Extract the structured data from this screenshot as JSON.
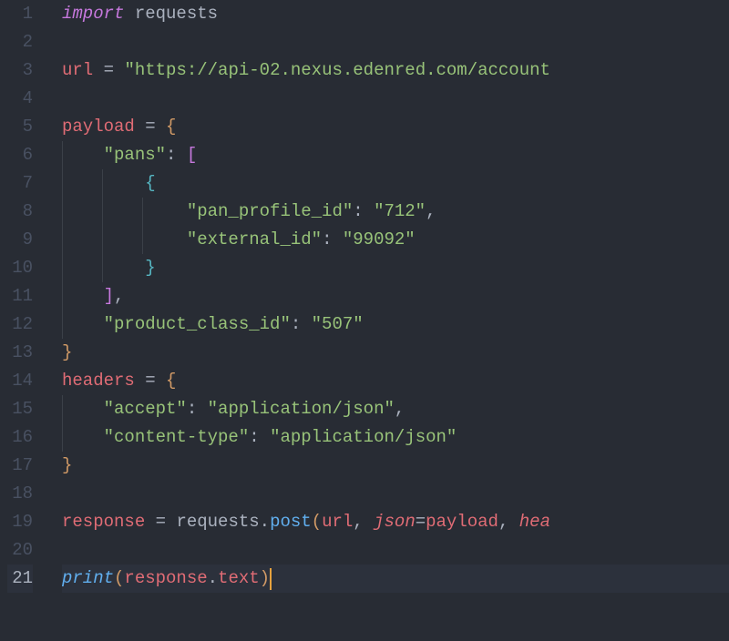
{
  "lines": [
    {
      "n": "1",
      "tokens": [
        {
          "t": "import",
          "c": "kw-import"
        },
        {
          "t": " ",
          "c": ""
        },
        {
          "t": "requests",
          "c": "module"
        }
      ]
    },
    {
      "n": "2",
      "tokens": []
    },
    {
      "n": "3",
      "tokens": [
        {
          "t": "url",
          "c": "var"
        },
        {
          "t": " ",
          "c": ""
        },
        {
          "t": "=",
          "c": "op"
        },
        {
          "t": " ",
          "c": ""
        },
        {
          "t": "\"https://api-02.nexus.edenred.com/account",
          "c": "str"
        }
      ]
    },
    {
      "n": "4",
      "tokens": []
    },
    {
      "n": "5",
      "tokens": [
        {
          "t": "payload",
          "c": "var"
        },
        {
          "t": " ",
          "c": ""
        },
        {
          "t": "=",
          "c": "op"
        },
        {
          "t": " ",
          "c": ""
        },
        {
          "t": "{",
          "c": "brace"
        }
      ]
    },
    {
      "n": "6",
      "indent": 1,
      "tokens": [
        {
          "t": "    ",
          "c": ""
        },
        {
          "t": "\"pans\"",
          "c": "str"
        },
        {
          "t": ":",
          "c": "punc"
        },
        {
          "t": " ",
          "c": ""
        },
        {
          "t": "[",
          "c": "brace2"
        }
      ]
    },
    {
      "n": "7",
      "indent": 2,
      "tokens": [
        {
          "t": "        ",
          "c": ""
        },
        {
          "t": "{",
          "c": "brace3"
        }
      ]
    },
    {
      "n": "8",
      "indent": 3,
      "tokens": [
        {
          "t": "            ",
          "c": ""
        },
        {
          "t": "\"pan_profile_id\"",
          "c": "str"
        },
        {
          "t": ":",
          "c": "punc"
        },
        {
          "t": " ",
          "c": ""
        },
        {
          "t": "\"712\"",
          "c": "str"
        },
        {
          "t": ",",
          "c": "punc"
        }
      ]
    },
    {
      "n": "9",
      "indent": 3,
      "tokens": [
        {
          "t": "            ",
          "c": ""
        },
        {
          "t": "\"external_id\"",
          "c": "str"
        },
        {
          "t": ":",
          "c": "punc"
        },
        {
          "t": " ",
          "c": ""
        },
        {
          "t": "\"99092\"",
          "c": "str"
        }
      ]
    },
    {
      "n": "10",
      "indent": 2,
      "tokens": [
        {
          "t": "        ",
          "c": ""
        },
        {
          "t": "}",
          "c": "brace3"
        }
      ]
    },
    {
      "n": "11",
      "indent": 1,
      "tokens": [
        {
          "t": "    ",
          "c": ""
        },
        {
          "t": "]",
          "c": "brace2"
        },
        {
          "t": ",",
          "c": "punc"
        }
      ]
    },
    {
      "n": "12",
      "indent": 1,
      "tokens": [
        {
          "t": "    ",
          "c": ""
        },
        {
          "t": "\"product_class_id\"",
          "c": "str"
        },
        {
          "t": ":",
          "c": "punc"
        },
        {
          "t": " ",
          "c": ""
        },
        {
          "t": "\"507\"",
          "c": "str"
        }
      ]
    },
    {
      "n": "13",
      "tokens": [
        {
          "t": "}",
          "c": "brace"
        }
      ]
    },
    {
      "n": "14",
      "tokens": [
        {
          "t": "headers",
          "c": "var"
        },
        {
          "t": " ",
          "c": ""
        },
        {
          "t": "=",
          "c": "op"
        },
        {
          "t": " ",
          "c": ""
        },
        {
          "t": "{",
          "c": "brace"
        }
      ]
    },
    {
      "n": "15",
      "indent": 1,
      "tokens": [
        {
          "t": "    ",
          "c": ""
        },
        {
          "t": "\"accept\"",
          "c": "str"
        },
        {
          "t": ":",
          "c": "punc"
        },
        {
          "t": " ",
          "c": ""
        },
        {
          "t": "\"application/json\"",
          "c": "str"
        },
        {
          "t": ",",
          "c": "punc"
        }
      ]
    },
    {
      "n": "16",
      "indent": 1,
      "tokens": [
        {
          "t": "    ",
          "c": ""
        },
        {
          "t": "\"content-type\"",
          "c": "str"
        },
        {
          "t": ":",
          "c": "punc"
        },
        {
          "t": " ",
          "c": ""
        },
        {
          "t": "\"application/json\"",
          "c": "str"
        }
      ]
    },
    {
      "n": "17",
      "tokens": [
        {
          "t": "}",
          "c": "brace"
        }
      ]
    },
    {
      "n": "18",
      "tokens": []
    },
    {
      "n": "19",
      "tokens": [
        {
          "t": "response",
          "c": "var"
        },
        {
          "t": " ",
          "c": ""
        },
        {
          "t": "=",
          "c": "op"
        },
        {
          "t": " ",
          "c": ""
        },
        {
          "t": "requests",
          "c": "module"
        },
        {
          "t": ".",
          "c": "punc"
        },
        {
          "t": "post",
          "c": "func"
        },
        {
          "t": "(",
          "c": "brace"
        },
        {
          "t": "url",
          "c": "var"
        },
        {
          "t": ",",
          "c": "punc"
        },
        {
          "t": " ",
          "c": ""
        },
        {
          "t": "json",
          "c": "param"
        },
        {
          "t": "=",
          "c": "op"
        },
        {
          "t": "payload",
          "c": "var"
        },
        {
          "t": ",",
          "c": "punc"
        },
        {
          "t": " ",
          "c": ""
        },
        {
          "t": "hea",
          "c": "param"
        }
      ]
    },
    {
      "n": "20",
      "tokens": []
    },
    {
      "n": "21",
      "current": true,
      "tokens": [
        {
          "t": "print",
          "c": "funcitalic"
        },
        {
          "t": "(",
          "c": "brace"
        },
        {
          "t": "response",
          "c": "var"
        },
        {
          "t": ".",
          "c": "punc"
        },
        {
          "t": "text",
          "c": "attr"
        },
        {
          "t": ")",
          "c": "brace"
        },
        {
          "cursor": true
        }
      ]
    }
  ]
}
